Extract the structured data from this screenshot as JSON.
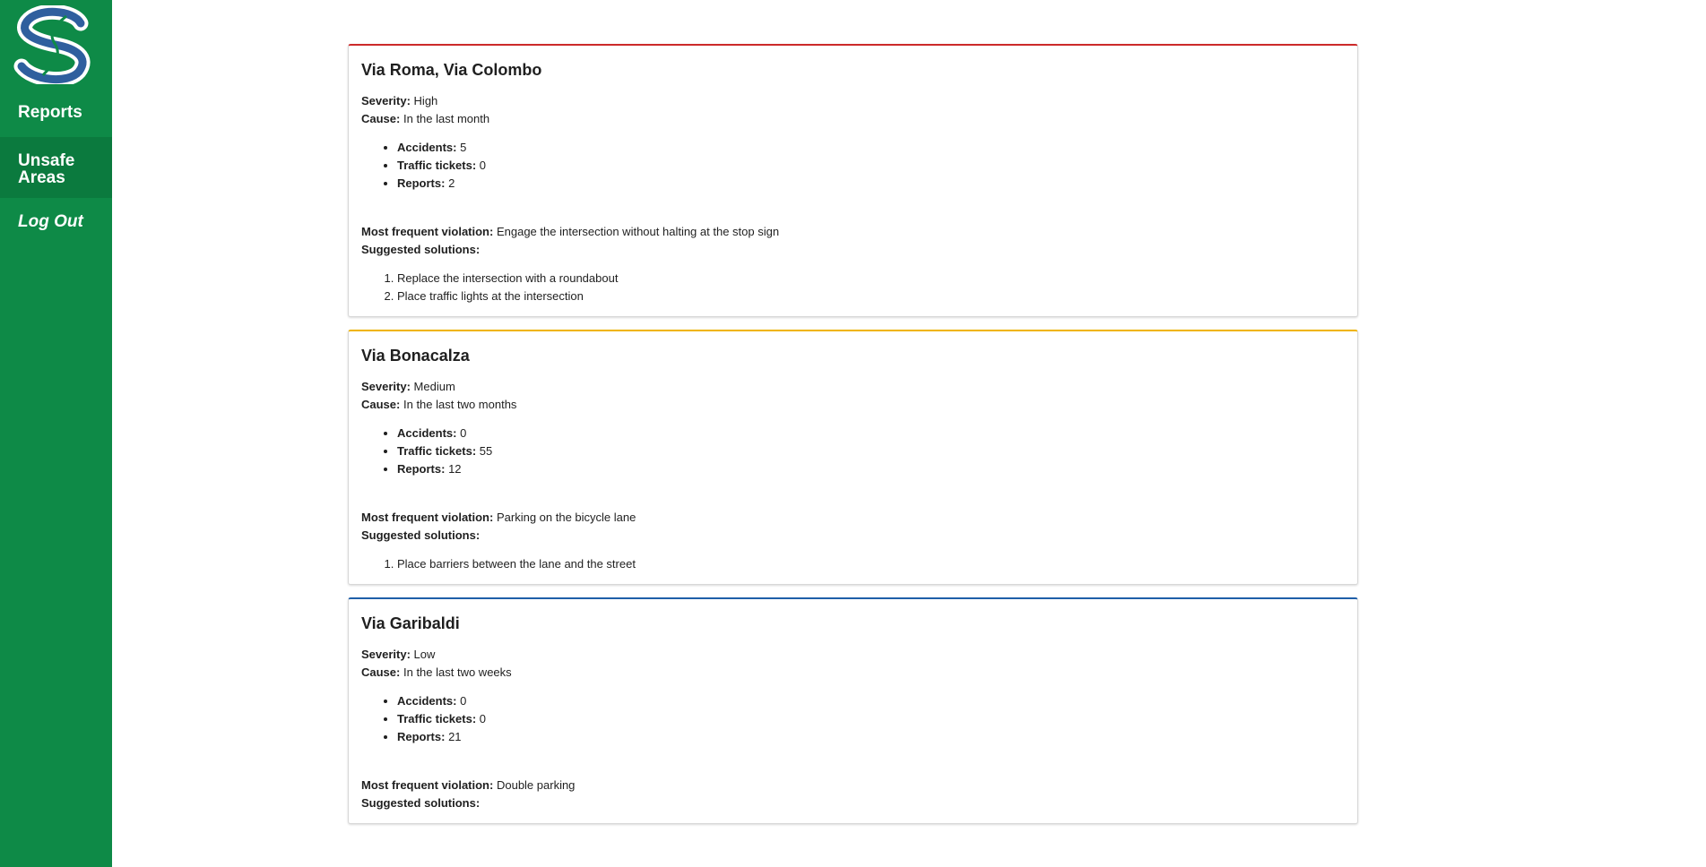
{
  "sidebar": {
    "logo_icon": "swirl-s-logo",
    "items": [
      {
        "label": "Reports"
      },
      {
        "label": "Unsafe Areas"
      },
      {
        "label": "Log Out"
      }
    ]
  },
  "colors": {
    "sidebar_green": "#0e8a47",
    "severity_high": "#cc2a2a",
    "severity_medium": "#f0b400",
    "severity_low": "#1f5fa8"
  },
  "labels": {
    "severity": "Severity:",
    "cause": "Cause:",
    "accidents": "Accidents:",
    "traffic_tickets": "Traffic tickets:",
    "reports": "Reports:",
    "most_frequent_violation": "Most frequent violation:",
    "suggested_solutions": "Suggested solutions:"
  },
  "areas": [
    {
      "title": "Via Roma, Via Colombo",
      "severity": "High",
      "cause": "In the last month",
      "accidents": "5",
      "traffic_tickets": "0",
      "reports": "2",
      "violation": "Engage the intersection without halting at the stop sign",
      "solutions": [
        "Replace the intersection with a roundabout",
        "Place traffic lights at the intersection"
      ]
    },
    {
      "title": "Via Bonacalza",
      "severity": "Medium",
      "cause": "In the last two months",
      "accidents": "0",
      "traffic_tickets": "55",
      "reports": "12",
      "violation": "Parking on the bicycle lane",
      "solutions": [
        "Place barriers between the lane and the street"
      ]
    },
    {
      "title": "Via Garibaldi",
      "severity": "Low",
      "cause": "In the last two weeks",
      "accidents": "0",
      "traffic_tickets": "0",
      "reports": "21",
      "violation": "Double parking",
      "solutions": []
    }
  ]
}
